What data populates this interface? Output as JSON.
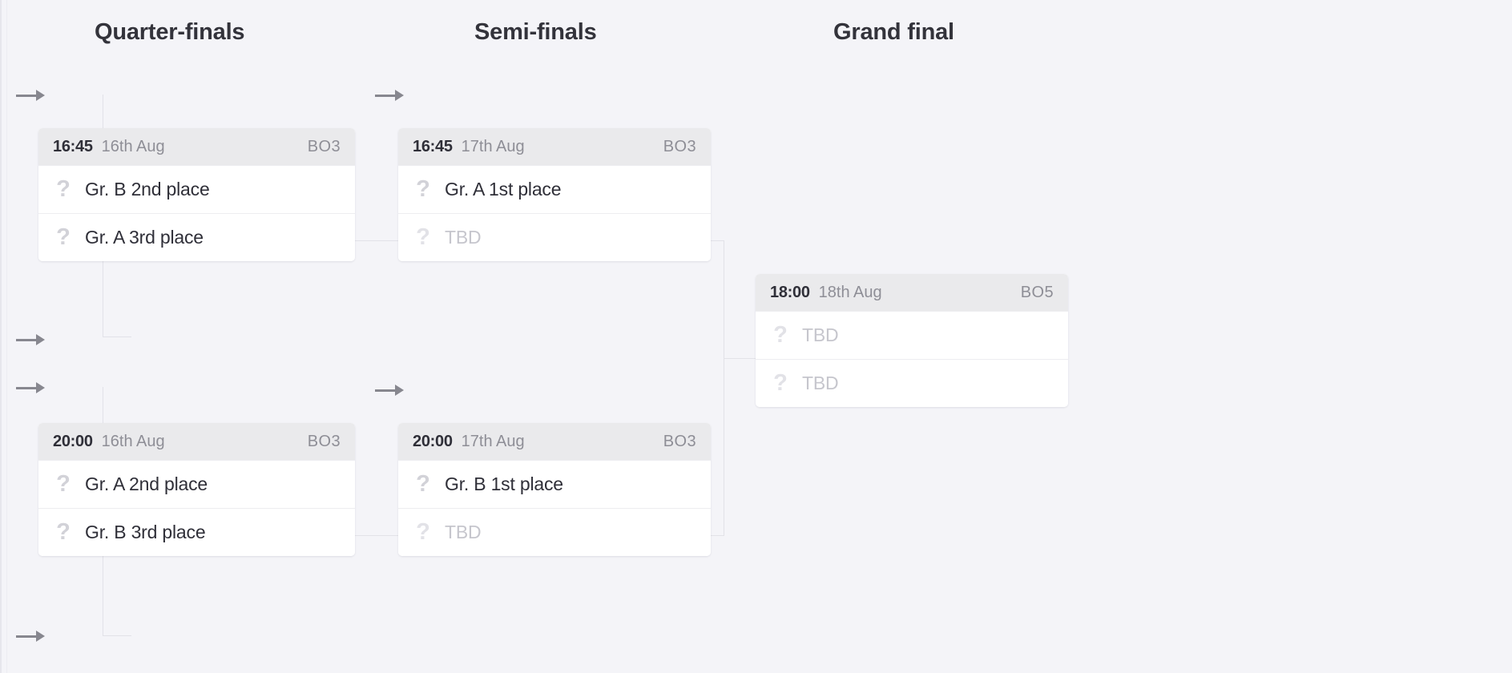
{
  "bracket": {
    "columns": [
      {
        "label": "Quarter-finals"
      },
      {
        "label": "Semi-finals"
      },
      {
        "label": "Grand final"
      }
    ],
    "matches": {
      "qf1": {
        "time": "16:45",
        "date": "16th Aug",
        "format": "BO3",
        "teams": [
          {
            "name": "Gr. B 2nd place",
            "icon": "?",
            "tbd": false
          },
          {
            "name": "Gr. A 3rd place",
            "icon": "?",
            "tbd": false
          }
        ]
      },
      "qf2": {
        "time": "20:00",
        "date": "16th Aug",
        "format": "BO3",
        "teams": [
          {
            "name": "Gr. A 2nd place",
            "icon": "?",
            "tbd": false
          },
          {
            "name": "Gr. B 3rd place",
            "icon": "?",
            "tbd": false
          }
        ]
      },
      "sf1": {
        "time": "16:45",
        "date": "17th Aug",
        "format": "BO3",
        "teams": [
          {
            "name": "Gr. A 1st place",
            "icon": "?",
            "tbd": false
          },
          {
            "name": "TBD",
            "icon": "?",
            "tbd": true
          }
        ]
      },
      "sf2": {
        "time": "20:00",
        "date": "17th Aug",
        "format": "BO3",
        "teams": [
          {
            "name": "Gr. B 1st place",
            "icon": "?",
            "tbd": false
          },
          {
            "name": "TBD",
            "icon": "?",
            "tbd": true
          }
        ]
      },
      "gf": {
        "time": "18:00",
        "date": "18th Aug",
        "format": "BO5",
        "teams": [
          {
            "name": "TBD",
            "icon": "?",
            "tbd": true
          },
          {
            "name": "TBD",
            "icon": "?",
            "tbd": true
          }
        ]
      }
    }
  },
  "colors": {
    "background": "#f4f4f8",
    "card": "#ffffff",
    "card_header": "#eaeaec",
    "text_primary": "#2f2f38",
    "text_muted": "#8e8e96",
    "text_tbd": "#c6c6cd",
    "connector": "#e2e2e8",
    "arrow": "#87878f"
  }
}
